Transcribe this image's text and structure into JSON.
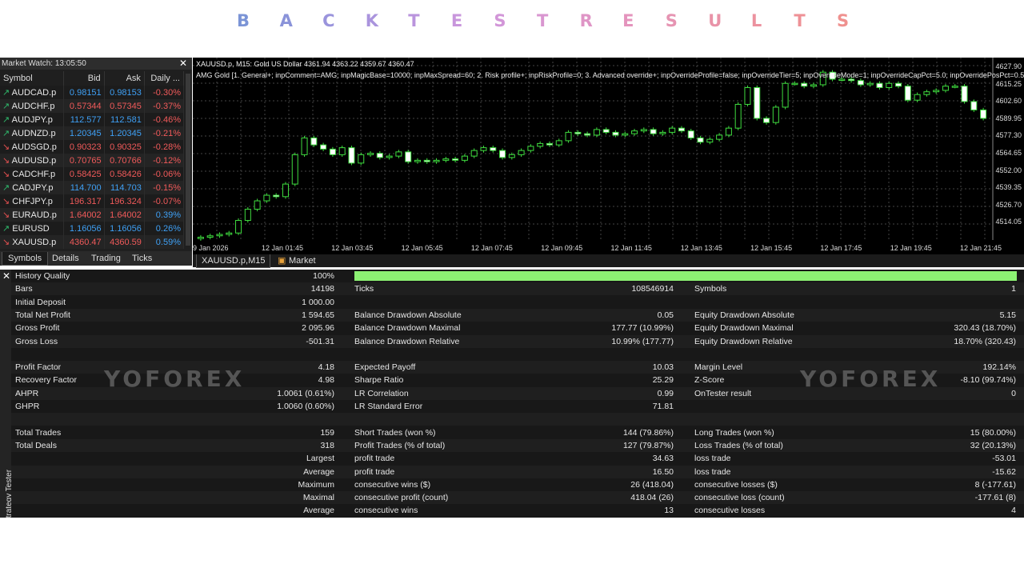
{
  "banner": {
    "letters": [
      "B",
      "A",
      "C",
      "K",
      "T",
      "E",
      "S",
      "T",
      "R",
      "E",
      "S",
      "U",
      "L",
      "T",
      "S"
    ],
    "colors": [
      "#7b94d6",
      "#8a93d9",
      "#9a94dc",
      "#aa94dd",
      "#ba94dd",
      "#c896dc",
      "#d296d8",
      "#d996d0",
      "#df95c6",
      "#e494bd",
      "#e694b2",
      "#e993a8",
      "#ec929f",
      "#ee9196",
      "#ef918f"
    ]
  },
  "market_watch": {
    "title": "Market Watch: 13:05:50",
    "columns": [
      "Symbol",
      "Bid",
      "Ask",
      "Daily ..."
    ],
    "rows": [
      {
        "dir": "up",
        "sym": "AUDCAD.p",
        "bid": "0.98151",
        "ask": "0.98153",
        "chg": "-0.30%",
        "bc": "up"
      },
      {
        "dir": "up",
        "sym": "AUDCHF.p",
        "bid": "0.57344",
        "ask": "0.57345",
        "chg": "-0.37%",
        "bc": "dn"
      },
      {
        "dir": "up",
        "sym": "AUDJPY.p",
        "bid": "112.577",
        "ask": "112.581",
        "chg": "-0.46%",
        "bc": "up"
      },
      {
        "dir": "up",
        "sym": "AUDNZD.p",
        "bid": "1.20345",
        "ask": "1.20345",
        "chg": "-0.21%",
        "bc": "up"
      },
      {
        "dir": "dn",
        "sym": "AUDSGD.p",
        "bid": "0.90323",
        "ask": "0.90325",
        "chg": "-0.28%",
        "bc": "dn"
      },
      {
        "dir": "dn",
        "sym": "AUDUSD.p",
        "bid": "0.70765",
        "ask": "0.70766",
        "chg": "-0.12%",
        "bc": "dn"
      },
      {
        "dir": "dn",
        "sym": "CADCHF.p",
        "bid": "0.58425",
        "ask": "0.58426",
        "chg": "-0.06%",
        "bc": "dn"
      },
      {
        "dir": "up",
        "sym": "CADJPY.p",
        "bid": "114.700",
        "ask": "114.703",
        "chg": "-0.15%",
        "bc": "up"
      },
      {
        "dir": "dn",
        "sym": "CHFJPY.p",
        "bid": "196.317",
        "ask": "196.324",
        "chg": "-0.07%",
        "bc": "dn"
      },
      {
        "dir": "dn",
        "sym": "EURAUD.p",
        "bid": "1.64002",
        "ask": "1.64002",
        "chg": "0.39%",
        "bc": "dn"
      },
      {
        "dir": "up",
        "sym": "EURUSD",
        "bid": "1.16056",
        "ask": "1.16056",
        "chg": "0.26%",
        "bc": "up"
      },
      {
        "dir": "dn",
        "sym": "XAUUSD.p",
        "bid": "4360.47",
        "ask": "4360.59",
        "chg": "0.59%",
        "bc": "dn"
      }
    ],
    "tabs": [
      "Symbols",
      "Details",
      "Trading",
      "Ticks"
    ]
  },
  "chart": {
    "info1": "XAUUSD.p, M15:  Gold US Dollar  4361.94 4363.22 4359.67 4360.47",
    "info2": "AMG Gold [1. General+; inpComment=AMG; inpMagicBase=10000; inpMaxSpread=60; 2. Risk profile+; inpRiskProfile=0; 3. Advanced override+; inpOverrideProfile=false; inpOverrideTier=5; inpOverrideMode=1; inpOverrideCapPct=5.0; inpOverridePosPct=0.5; inpFixedL",
    "y_ticks": [
      "4627.90",
      "4615.25",
      "4602.60",
      "4589.95",
      "4577.30",
      "4564.65",
      "4552.00",
      "4539.35",
      "4526.70",
      "4514.05"
    ],
    "x_ticks": [
      "9 Jan 2026",
      "12 Jan 01:45",
      "12 Jan 03:45",
      "12 Jan 05:45",
      "12 Jan 07:45",
      "12 Jan 09:45",
      "12 Jan 11:45",
      "12 Jan 13:45",
      "12 Jan 15:45",
      "12 Jan 17:45",
      "12 Jan 19:45",
      "12 Jan 21:45"
    ],
    "ylim": [
      4505,
      4632
    ],
    "closes": [
      4507,
      4508,
      4509,
      4510,
      4519,
      4527,
      4533,
      4537,
      4536,
      4545,
      4566,
      4578,
      4573,
      4570,
      4566,
      4571,
      4560,
      4566,
      4567,
      4564,
      4565,
      4568,
      4561,
      4562,
      4561,
      4562,
      4563,
      4562,
      4565,
      4569,
      4571,
      4569,
      4564,
      4566,
      4569,
      4572,
      4574,
      4573,
      4576,
      4582,
      4581,
      4580,
      4584,
      4582,
      4580,
      4581,
      4583,
      4584,
      4581,
      4582,
      4585,
      4583,
      4578,
      4575,
      4577,
      4580,
      4585,
      4602,
      4614,
      4592,
      4589,
      4600,
      4617,
      4617,
      4615,
      4616,
      4625,
      4620,
      4620,
      4619,
      4616,
      4617,
      4614,
      4617,
      4615,
      4605,
      4609,
      4611,
      4612,
      4615,
      4615,
      4604,
      4598,
      4592
    ],
    "tabs": [
      "XAUUSD.p,M15",
      "Market"
    ]
  },
  "tester": {
    "quality_label": "History Quality",
    "quality_value": "100%",
    "rows": [
      [
        [
          "Bars",
          "14198"
        ],
        [
          "Ticks",
          "108546914"
        ],
        [
          "Symbols",
          "1"
        ]
      ],
      [
        [
          "Initial Deposit",
          "1 000.00"
        ],
        [
          "",
          ""
        ],
        [
          "",
          ""
        ]
      ],
      [
        [
          "Total Net Profit",
          "1 594.65"
        ],
        [
          "Balance Drawdown Absolute",
          "0.05"
        ],
        [
          "Equity Drawdown Absolute",
          "5.15"
        ]
      ],
      [
        [
          "Gross Profit",
          "2 095.96"
        ],
        [
          "Balance Drawdown Maximal",
          "177.77 (10.99%)"
        ],
        [
          "Equity Drawdown Maximal",
          "320.43 (18.70%)"
        ]
      ],
      [
        [
          "Gross Loss",
          "-501.31"
        ],
        [
          "Balance Drawdown Relative",
          "10.99% (177.77)"
        ],
        [
          "Equity Drawdown Relative",
          "18.70% (320.43)"
        ]
      ],
      [
        [
          "",
          ""
        ],
        [
          "",
          ""
        ],
        [
          "",
          ""
        ]
      ],
      [
        [
          "Profit Factor",
          "4.18"
        ],
        [
          "Expected Payoff",
          "10.03"
        ],
        [
          "Margin Level",
          "192.14%"
        ]
      ],
      [
        [
          "Recovery Factor",
          "4.98"
        ],
        [
          "Sharpe Ratio",
          "25.29"
        ],
        [
          "Z-Score",
          "-8.10 (99.74%)"
        ]
      ],
      [
        [
          "AHPR",
          "1.0061 (0.61%)"
        ],
        [
          "LR Correlation",
          "0.99"
        ],
        [
          "OnTester result",
          "0"
        ]
      ],
      [
        [
          "GHPR",
          "1.0060 (0.60%)"
        ],
        [
          "LR Standard Error",
          "71.81"
        ],
        [
          "",
          ""
        ]
      ],
      [
        [
          "",
          ""
        ],
        [
          "",
          ""
        ],
        [
          "",
          ""
        ]
      ],
      [
        [
          "Total Trades",
          "159"
        ],
        [
          "Short Trades (won %)",
          "144 (79.86%)"
        ],
        [
          "Long Trades (won %)",
          "15 (80.00%)"
        ]
      ],
      [
        [
          "Total Deals",
          "318"
        ],
        [
          "Profit Trades (% of total)",
          "127 (79.87%)"
        ],
        [
          "Loss Trades (% of total)",
          "32 (20.13%)"
        ]
      ]
    ],
    "rows2": [
      [
        "Largest",
        "profit trade",
        "34.63",
        "loss trade",
        "-53.01"
      ],
      [
        "Average",
        "profit trade",
        "16.50",
        "loss trade",
        "-15.62"
      ],
      [
        "Maximum",
        "consecutive wins ($)",
        "26 (418.04)",
        "consecutive losses ($)",
        "8 (-177.61)"
      ],
      [
        "Maximal",
        "consecutive profit (count)",
        "418.04 (26)",
        "consecutive loss (count)",
        "-177.61 (8)"
      ],
      [
        "Average",
        "consecutive wins",
        "13",
        "consecutive losses",
        "4"
      ]
    ],
    "side_label": "Strategy Tester"
  },
  "watermark": "YOFOREX"
}
